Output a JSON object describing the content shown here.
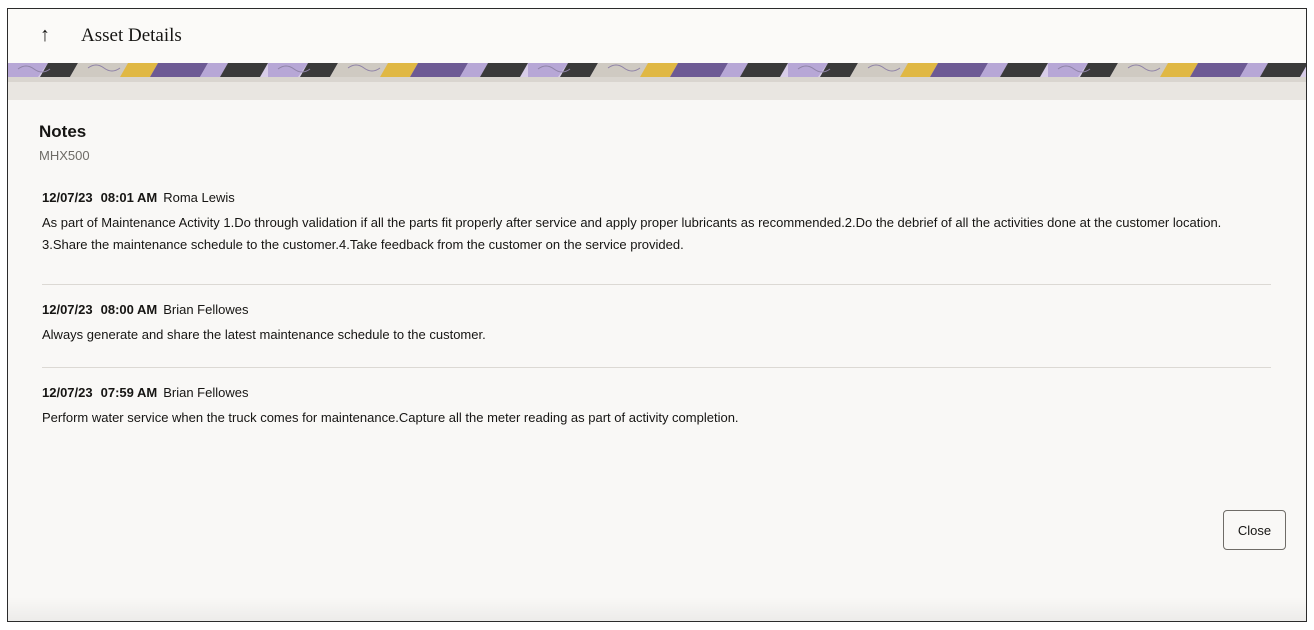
{
  "header": {
    "title": "Asset Details",
    "back_icon": "up-arrow-icon",
    "back_glyph": "↑"
  },
  "banner": {
    "colors": [
      "#b7a7d6",
      "#d8cde8",
      "#3a3a3a",
      "#6d5a94",
      "#e0b844",
      "#cfcac2"
    ]
  },
  "panel": {
    "title": "Notes",
    "asset_code": "MHX500"
  },
  "notes": [
    {
      "date": "12/07/23",
      "time": "08:01 AM",
      "author": "Roma Lewis",
      "text_line1": "As part of Maintenance Activity 1.Do through validation if all the parts fit properly after service and apply proper lubricants as recommended.2.Do the debrief of all the activities done at the customer location.",
      "text_line2": "3.Share the maintenance schedule to the customer.4.Take feedback from the customer on the service provided."
    },
    {
      "date": "12/07/23",
      "time": "08:00 AM",
      "author": "Brian Fellowes",
      "text_line1": "Always generate and share the latest maintenance schedule to the customer."
    },
    {
      "date": "12/07/23",
      "time": "07:59 AM",
      "author": "Brian Fellowes",
      "text_line1": "Perform water service when the truck comes for maintenance.Capture  all the meter reading as part of activity completion."
    }
  ],
  "footer": {
    "close_label": "Close"
  }
}
